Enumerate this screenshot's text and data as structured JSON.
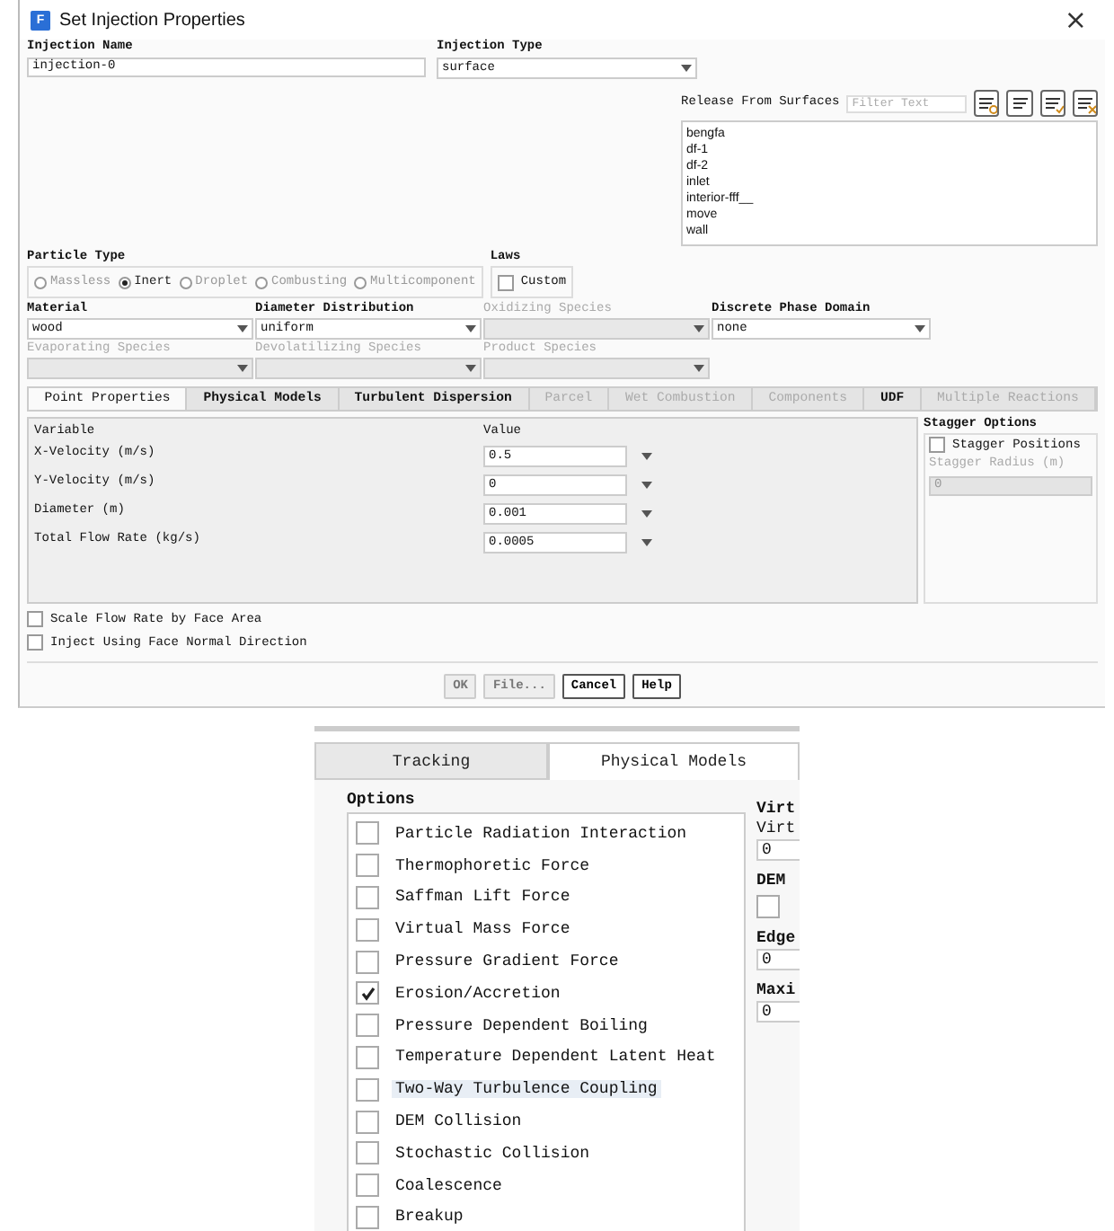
{
  "window": {
    "icon": "F",
    "title": "Set Injection Properties",
    "close": "×"
  },
  "injection_name": {
    "label": "Injection Name",
    "value": "injection-0"
  },
  "injection_type": {
    "label": "Injection Type",
    "value": "surface"
  },
  "release_from_surfaces": {
    "label": "Release From Surfaces",
    "placeholder": "Filter Text",
    "surfaces": [
      "bengfa",
      "df-1",
      "df-2",
      "inlet",
      "interior-fff__",
      "move",
      "wall"
    ]
  },
  "particle_type": {
    "label": "Particle Type",
    "options": [
      {
        "label": "Massless",
        "selected": false
      },
      {
        "label": "Inert",
        "selected": true
      },
      {
        "label": "Droplet",
        "selected": false
      },
      {
        "label": "Combusting",
        "selected": false
      },
      {
        "label": "Multicomponent",
        "selected": false
      }
    ]
  },
  "laws": {
    "label": "Laws",
    "custom": {
      "label": "Custom",
      "checked": false
    }
  },
  "dropdowns": [
    {
      "label": "Material",
      "value": "wood",
      "disabled": false
    },
    {
      "label": "Diameter Distribution",
      "value": "uniform",
      "disabled": false
    },
    {
      "label": "Oxidizing Species",
      "disabled": true
    },
    {
      "label": "Discrete Phase Domain",
      "value": "none",
      "disabled": false
    },
    {
      "label": "Evaporating Species",
      "disabled": true
    },
    {
      "label": "Devolatilizing Species",
      "disabled": true
    },
    {
      "label": "Product Species",
      "disabled": true
    }
  ],
  "tabs": [
    {
      "label": "Point Properties",
      "selected": true,
      "disabled": false
    },
    {
      "label": "Physical Models",
      "selected": false,
      "disabled": false
    },
    {
      "label": "Turbulent Dispersion",
      "selected": false,
      "disabled": false
    },
    {
      "label": "Parcel",
      "selected": false,
      "disabled": true
    },
    {
      "label": "Wet Combustion",
      "selected": false,
      "disabled": true
    },
    {
      "label": "Components",
      "selected": false,
      "disabled": true
    },
    {
      "label": "UDF",
      "selected": false,
      "disabled": false
    },
    {
      "label": "Multiple Reactions",
      "selected": false,
      "disabled": true
    }
  ],
  "point_properties": {
    "columns": [
      "Variable",
      "Value"
    ],
    "rows": [
      {
        "variable": "X-Velocity (m/s)",
        "value": "0.5"
      },
      {
        "variable": "Y-Velocity (m/s)",
        "value": "0"
      },
      {
        "variable": "Diameter (m)",
        "value": "0.001"
      },
      {
        "variable": "Total Flow Rate (kg/s)",
        "value": "0.0005"
      }
    ]
  },
  "stagger_options": {
    "title": "Stagger Options",
    "positions": {
      "label": "Stagger Positions",
      "checked": false
    },
    "radius": {
      "label": "Stagger Radius (m)",
      "value": "0",
      "disabled": true
    }
  },
  "options": [
    {
      "label": "Scale Flow Rate by Face Area",
      "checked": false
    },
    {
      "label": "Inject Using Face Normal Direction",
      "checked": false
    }
  ],
  "buttons": [
    {
      "label": "OK",
      "disabled": true
    },
    {
      "label": "File...",
      "disabled": true
    },
    {
      "label": "Cancel",
      "disabled": false
    },
    {
      "label": "Help",
      "disabled": false
    }
  ],
  "detail_panel": {
    "tabs": [
      {
        "label": "Tracking",
        "selected": false
      },
      {
        "label": "Physical Models",
        "selected": true
      }
    ],
    "options_title": "Options",
    "options": [
      {
        "label": "Particle Radiation Interaction",
        "checked": false,
        "selected": false
      },
      {
        "label": "Thermophoretic Force",
        "checked": false,
        "selected": false
      },
      {
        "label": "Saffman Lift Force",
        "checked": false,
        "selected": false
      },
      {
        "label": "Virtual Mass Force",
        "checked": false,
        "selected": false
      },
      {
        "label": "Pressure Gradient Force",
        "checked": false,
        "selected": false
      },
      {
        "label": "Erosion/Accretion",
        "checked": true,
        "selected": false
      },
      {
        "label": "Pressure Dependent Boiling",
        "checked": false,
        "selected": false
      },
      {
        "label": "Temperature Dependent Latent Heat",
        "checked": false,
        "selected": false
      },
      {
        "label": "Two-Way Turbulence Coupling",
        "checked": false,
        "selected": true
      },
      {
        "label": "DEM Collision",
        "checked": false,
        "selected": false
      },
      {
        "label": "Stochastic Collision",
        "checked": false,
        "selected": false
      },
      {
        "label": "Coalescence",
        "checked": false,
        "selected": false
      },
      {
        "label": "Breakup",
        "checked": false,
        "selected": false
      }
    ],
    "side_items": [
      {
        "kind": "heading",
        "text": "Virt"
      },
      {
        "kind": "label",
        "text": "Virt"
      },
      {
        "kind": "field",
        "text": "0"
      },
      {
        "kind": "heading",
        "text": "DEM"
      },
      {
        "kind": "checkbox",
        "checked": false
      },
      {
        "kind": "heading",
        "text": "Edge"
      },
      {
        "kind": "field",
        "text": "0"
      },
      {
        "kind": "heading",
        "text": "Maxi"
      },
      {
        "kind": "field",
        "text": "0"
      }
    ]
  }
}
